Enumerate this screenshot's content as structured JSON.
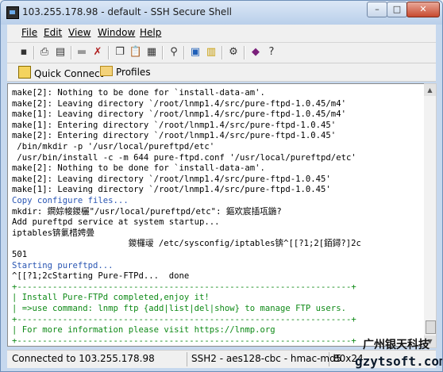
{
  "window": {
    "title": "103.255.178.98 - default - SSH Secure Shell",
    "min": "–",
    "max": "□",
    "close": "✕"
  },
  "menu": [
    "File",
    "Edit",
    "View",
    "Window",
    "Help"
  ],
  "toolbar_icons": [
    "save-icon",
    "print-icon",
    "print-preview-icon",
    "disabled-icon",
    "disconnect-icon",
    "copy-icon",
    "paste-icon",
    "paste-special-icon",
    "find-icon",
    "new-terminal-icon",
    "new-sftp-icon",
    "settings-icon",
    "key-book-icon",
    "help-icon"
  ],
  "profile_bar": {
    "quick_connect": "Quick Connect",
    "profiles": "Profiles"
  },
  "terminal_lines": [
    {
      "text": "make[2]: Nothing to be done for `install-data-am'.",
      "color": "black"
    },
    {
      "text": "make[2]: Leaving directory `/root/lnmp1.4/src/pure-ftpd-1.0.45/m4'",
      "color": "black"
    },
    {
      "text": "make[1]: Leaving directory `/root/lnmp1.4/src/pure-ftpd-1.0.45/m4'",
      "color": "black"
    },
    {
      "text": "make[1]: Entering directory `/root/lnmp1.4/src/pure-ftpd-1.0.45'",
      "color": "black"
    },
    {
      "text": "make[2]: Entering directory `/root/lnmp1.4/src/pure-ftpd-1.0.45'",
      "color": "black"
    },
    {
      "text": " /bin/mkdir -p '/usr/local/pureftpd/etc'",
      "color": "black"
    },
    {
      "text": " /usr/bin/install -c -m 644 pure-ftpd.conf '/usr/local/pureftpd/etc'",
      "color": "black"
    },
    {
      "text": "make[2]: Nothing to be done for `install-data-am'.",
      "color": "black"
    },
    {
      "text": "make[2]: Leaving directory `/root/lnmp1.4/src/pure-ftpd-1.0.45'",
      "color": "black"
    },
    {
      "text": "make[1]: Leaving directory `/root/lnmp1.4/src/pure-ftpd-1.0.45'",
      "color": "black"
    },
    {
      "text": "Copy configure files...",
      "color": "blue"
    },
    {
      "text": "mkdir: 鐧婃帹鍐欐\"/usr/local/pureftpd/etc\": 鏂欢宸插瓨鍦?",
      "color": "black"
    },
    {
      "text": "Add pureftpd service at system startup...",
      "color": "black"
    },
    {
      "text": "iptables锛氭棤娉曡",
      "color": "black"
    },
    {
      "text": "                       鍐欏叆 /etc/sysconfig/iptables锛^[[?1;2[銆鐞?]2c",
      "color": "black"
    },
    {
      "text": "501",
      "color": "black"
    },
    {
      "text": "Starting pureftpd...",
      "color": "blue"
    },
    {
      "text": "^[[?1;2cStarting Pure-FTPd...  done",
      "color": "black"
    },
    {
      "text": "+------------------------------------------------------------------+",
      "color": "green"
    },
    {
      "text": "| Install Pure-FTPd completed,enjoy it!",
      "color": "green"
    },
    {
      "text": "| =>use command: lnmp ftp {add|list|del|show} to manage FTP users.",
      "color": "green"
    },
    {
      "text": "+------------------------------------------------------------------+",
      "color": "green"
    },
    {
      "text": "| For more information please visit https://lnmp.org",
      "color": "green"
    },
    {
      "text": "+------------------------------------------------------------------+",
      "color": "green"
    }
  ],
  "status": {
    "connection": "Connected to 103.255.178.98",
    "cipher": "SSH2 - aes128-cbc - hmac-md5",
    "size": "80x24"
  },
  "watermark": {
    "line1": "广州银天科技",
    "line2": "gzytsoft.com"
  }
}
